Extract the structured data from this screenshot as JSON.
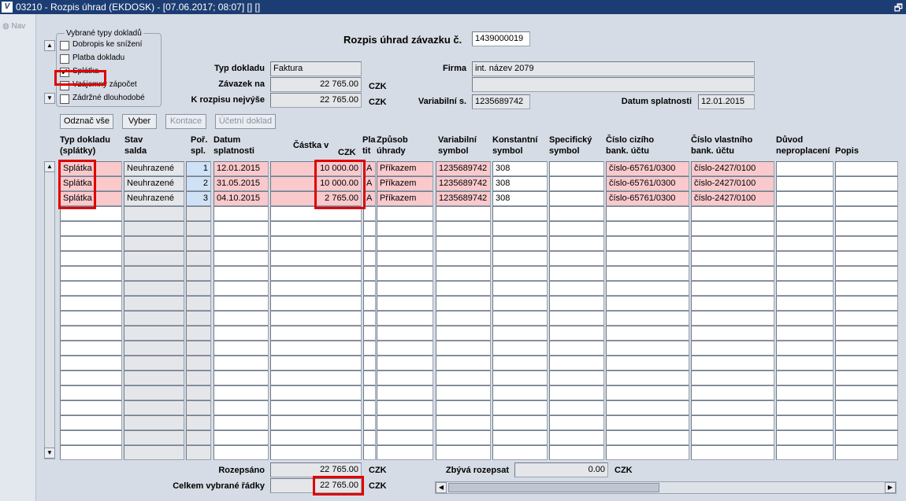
{
  "window": {
    "title": "03210 - Rozpis úhrad (EKDOSK) - [07.06.2017; 08:07] [] []",
    "icon": "app-logo-icon",
    "restore_icon": "restore-window-icon",
    "restore_glyph": "🗗"
  },
  "left": {
    "nav_label": "Nav"
  },
  "filter": {
    "title": "Vybrané typy dokladů",
    "items": [
      {
        "label": "Dobropis ke snížení",
        "checked": false
      },
      {
        "label": "Platba dokladu",
        "checked": false
      },
      {
        "label": "Splátka",
        "checked": true
      },
      {
        "label": "Vzájemný zápočet",
        "checked": false
      },
      {
        "label": "Zádržné dlouhodobé",
        "checked": false
      }
    ]
  },
  "header": {
    "heading": "Rozpis úhrad závazku č.",
    "heading_value": "1439000019",
    "typ_dokladu_label": "Typ dokladu",
    "typ_dokladu": "Faktura",
    "zavazek_label": "Závazek na",
    "zavazek": "22 765.00",
    "zavazek_currency": "CZK",
    "k_rozpisu_label": "K rozpisu nejvýše",
    "k_rozpisu": "22 765.00",
    "k_rozpisu_currency": "CZK",
    "firma_label": "Firma",
    "firma": "int. název 2079",
    "firma2": "",
    "variabilni_label": "Variabilní s.",
    "variabilni": "1235689742",
    "datum_splatnosti_label": "Datum splatnosti",
    "datum_splatnosti": "12.01.2015"
  },
  "buttons": {
    "oznac_vse": "Odznač vše",
    "vyber": "Vyber",
    "kontace": "Kontace",
    "ucetni_doklad": "Účetní doklad"
  },
  "columns": {
    "typ1": "Typ dokladu",
    "typ2": "(splátky)",
    "stav1": "Stav",
    "stav2": "salda",
    "por1": "Poř.",
    "por2": "spl.",
    "datum1": "Datum",
    "datum2": "splatnosti",
    "castka1": "Částka v",
    "castka2": "CZK",
    "plat1": "Pla",
    "plat2": "tit",
    "zpusob1": "Způsob",
    "zpusob2": "úhrady",
    "var1": "Variabilní",
    "var2": "symbol",
    "konst1": "Konstantní",
    "konst2": "symbol",
    "spec1": "Specifický",
    "spec2": "symbol",
    "cizi1": "Číslo cizího",
    "cizi2": "bank. účtu",
    "vlast1": "Číslo vlastního",
    "vlast2": "bank. účtu",
    "duvod1": "Důvod",
    "duvod2": "neproplacení",
    "popis": "Popis"
  },
  "rows": [
    {
      "typ": "Splátka",
      "stav": "Neuhrazené",
      "por": "1",
      "datum": "12.01.2015",
      "castka": "10 000.00",
      "plat": "A",
      "zpusob": "Příkazem",
      "var": "1235689742",
      "konst": "308",
      "spec": "",
      "cizi": "číslo-65761/0300",
      "vlast": "číslo-2427/0100",
      "duvod": "",
      "popis": ""
    },
    {
      "typ": "Splátka",
      "stav": "Neuhrazené",
      "por": "2",
      "datum": "31.05.2015",
      "castka": "10 000.00",
      "plat": "A",
      "zpusob": "Příkazem",
      "var": "1235689742",
      "konst": "308",
      "spec": "",
      "cizi": "číslo-65761/0300",
      "vlast": "číslo-2427/0100",
      "duvod": "",
      "popis": ""
    },
    {
      "typ": "Splátka",
      "stav": "Neuhrazené",
      "por": "3",
      "datum": "04.10.2015",
      "castka": "2 765.00",
      "plat": "A",
      "zpusob": "Příkazem",
      "var": "1235689742",
      "konst": "308",
      "spec": "",
      "cizi": "číslo-65761/0300",
      "vlast": "číslo-2427/0100",
      "duvod": "",
      "popis": ""
    }
  ],
  "footer": {
    "rozepsano_label": "Rozepsáno",
    "rozepsano": "22 765.00",
    "rozepsano_currency": "CZK",
    "celkem_label": "Celkem vybrané řádky",
    "celkem": "22 765.00",
    "celkem_currency": "CZK",
    "zbyva_label": "Zbývá rozepsat",
    "zbyva": "0.00",
    "zbyva_currency": "CZK"
  },
  "colors": {
    "pink": "#f9c9cc",
    "highlight_red": "#e00000",
    "titlebar": "#1c3d73"
  }
}
